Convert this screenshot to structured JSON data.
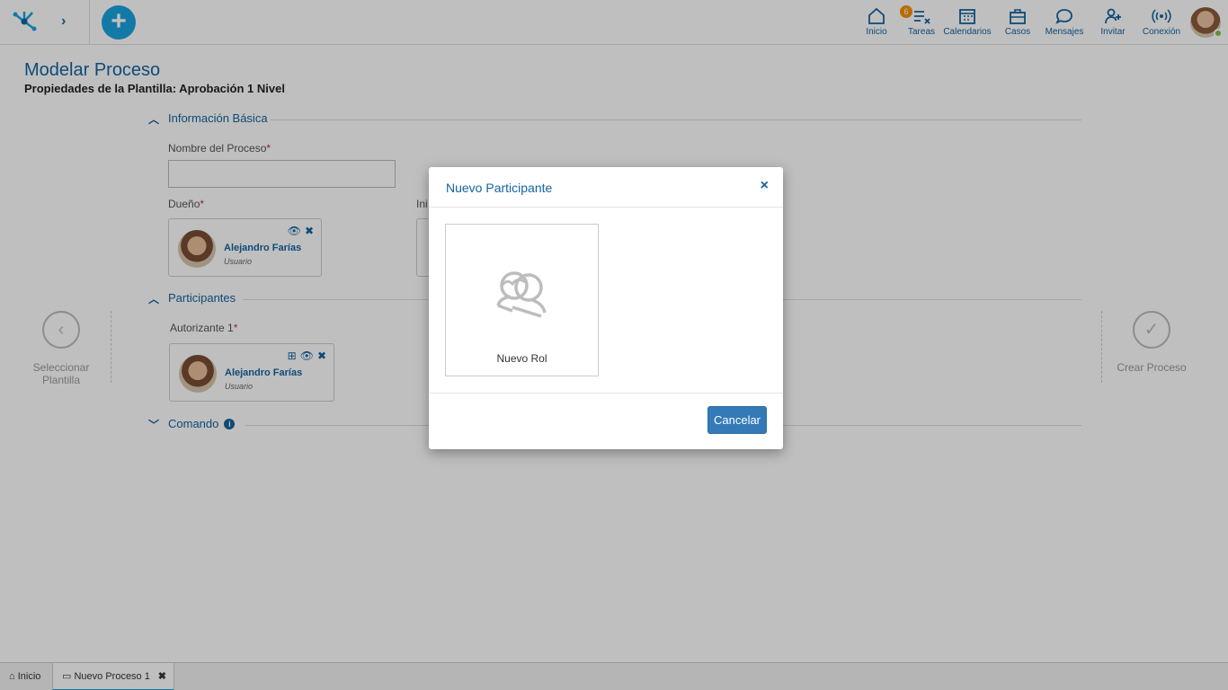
{
  "topbar": {
    "nav": [
      {
        "id": "inicio",
        "label": "Inicio",
        "icon": "home-icon"
      },
      {
        "id": "tareas",
        "label": "Tareas",
        "icon": "tasks-icon",
        "badge": "6"
      },
      {
        "id": "calendarios",
        "label": "Calendarios",
        "icon": "calendar-icon"
      },
      {
        "id": "casos",
        "label": "Casos",
        "icon": "briefcase-icon"
      },
      {
        "id": "mensajes",
        "label": "Mensajes",
        "icon": "chat-icon"
      },
      {
        "id": "invitar",
        "label": "Invitar",
        "icon": "add-user-icon"
      },
      {
        "id": "conexion",
        "label": "Conexión",
        "icon": "broadcast-icon"
      }
    ],
    "add_button": "+",
    "chevron": "›"
  },
  "page": {
    "title": "Modelar Proceso",
    "subtitle": "Propiedades de la Plantilla: Aprobación 1 Nivel",
    "sections": {
      "basic": "Información Básica",
      "participants": "Participantes",
      "command": "Comando"
    },
    "fields": {
      "process_name_label": "Nombre del Proceso",
      "owner_label": "Dueño",
      "authorizer_label": "Autorizante 1",
      "initiator_label_partial": "Ini",
      "required_mark": "*"
    },
    "owner": {
      "name": "Alejandro Farías",
      "role": "Usuario"
    },
    "authorizer": {
      "name": "Alejandro Farías",
      "role": "Usuario"
    },
    "steps": {
      "prev": "Seleccionar Plantilla",
      "next": "Crear Proceso"
    }
  },
  "bottom_tabs": [
    {
      "label": "Inicio",
      "icon": "home-icon"
    },
    {
      "label": "Nuevo Proceso 1",
      "icon": "window-icon",
      "close": "✖"
    }
  ],
  "modal": {
    "title": "Nuevo Participante",
    "close": "×",
    "tile_label": "Nuevo Rol",
    "cancel": "Cancelar"
  },
  "colors": {
    "primary": "#15639f",
    "accent": "#1aa3e0",
    "badge": "#f39200",
    "button": "#337ab7",
    "online": "#7cc144"
  }
}
